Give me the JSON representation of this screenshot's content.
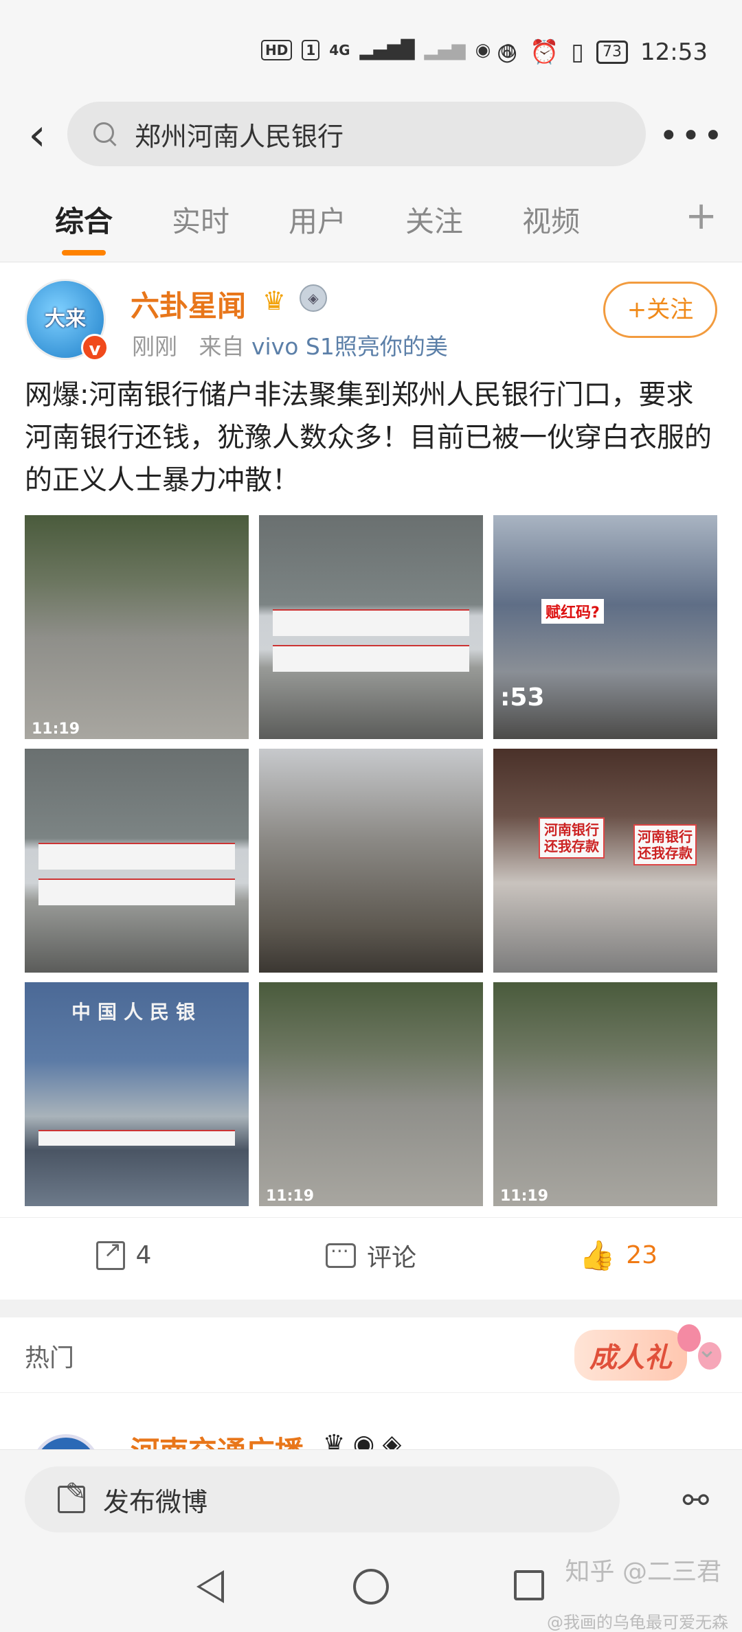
{
  "status_bar": {
    "left_icons": [
      "HD",
      "1",
      "4G",
      "signal-bars",
      "no-signal",
      "wechat",
      "app-icon"
    ],
    "battery": "73",
    "time": "12:53"
  },
  "search": {
    "query": "郑州河南人民银行"
  },
  "tabs": [
    "综合",
    "实时",
    "用户",
    "关注",
    "视频"
  ],
  "tab_add": "+",
  "post": {
    "author": "六卦星闻",
    "avatar_text": "大来",
    "verified": "v",
    "meta_time": "刚刚",
    "meta_from": "来自",
    "meta_source": "vivo S1照亮你的美",
    "follow_label": "+关注",
    "text": "网爆:河南银行储户非法聚集到郑州人民银行门口，要求河南银行还钱，犹豫人数众多！目前已被一伙穿白衣服的的正义人士暴力冲散！",
    "photos": [
      {
        "type": "crowd",
        "time": "11:19"
      },
      {
        "type": "banner"
      },
      {
        "type": "protest",
        "time": ":53",
        "sign": "赋红码?"
      },
      {
        "type": "banner"
      },
      {
        "type": "people"
      },
      {
        "type": "kids",
        "sign1": "河南银行还我存款",
        "sign2": "河南银行还我存款"
      },
      {
        "type": "bank",
        "title": "中国人民银"
      },
      {
        "type": "crowd",
        "time": "11:19"
      },
      {
        "type": "crowd",
        "time": "11:19"
      }
    ],
    "share_count": "4",
    "comment_label": "评论",
    "like_count": "23"
  },
  "hot": {
    "label": "热门",
    "badge": "成人礼"
  },
  "next_post": {
    "author": "河南交通广播"
  },
  "compose": {
    "label": "发布微博"
  },
  "watermark": {
    "line1": "知乎 @二三君",
    "line2": "@我画的乌龟最可爱无森"
  },
  "colors": {
    "accent": "#ff8200",
    "author": "#e8761a",
    "source_link": "#5b7fa8"
  }
}
